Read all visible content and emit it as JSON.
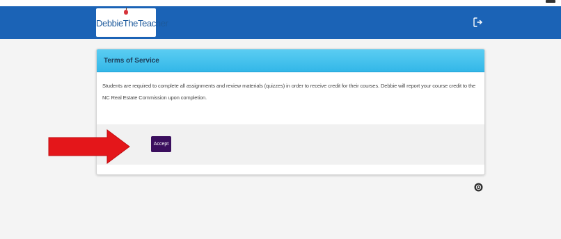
{
  "header": {
    "logo": {
      "text_part1": "Debbie",
      "text_part2": "TheTeacher"
    },
    "logout_icon": "sign-out-icon"
  },
  "terms_card": {
    "title": "Terms of Service",
    "body": "Students are required to complete all assignments and review materials (quizzes) in order to receive credit for their courses. Debbie will report your course credit to the NC Real Estate Commission upon completion.",
    "accept_label": "Accept"
  },
  "annotations": {
    "arrow_icon": "red-arrow-icon",
    "arrow_color": "#e4161a"
  },
  "colors": {
    "navbar": "#1b63b6",
    "card_header": "#33b7e8",
    "accept_button": "#3b0f5e",
    "page_background": "#f4f4f4"
  }
}
